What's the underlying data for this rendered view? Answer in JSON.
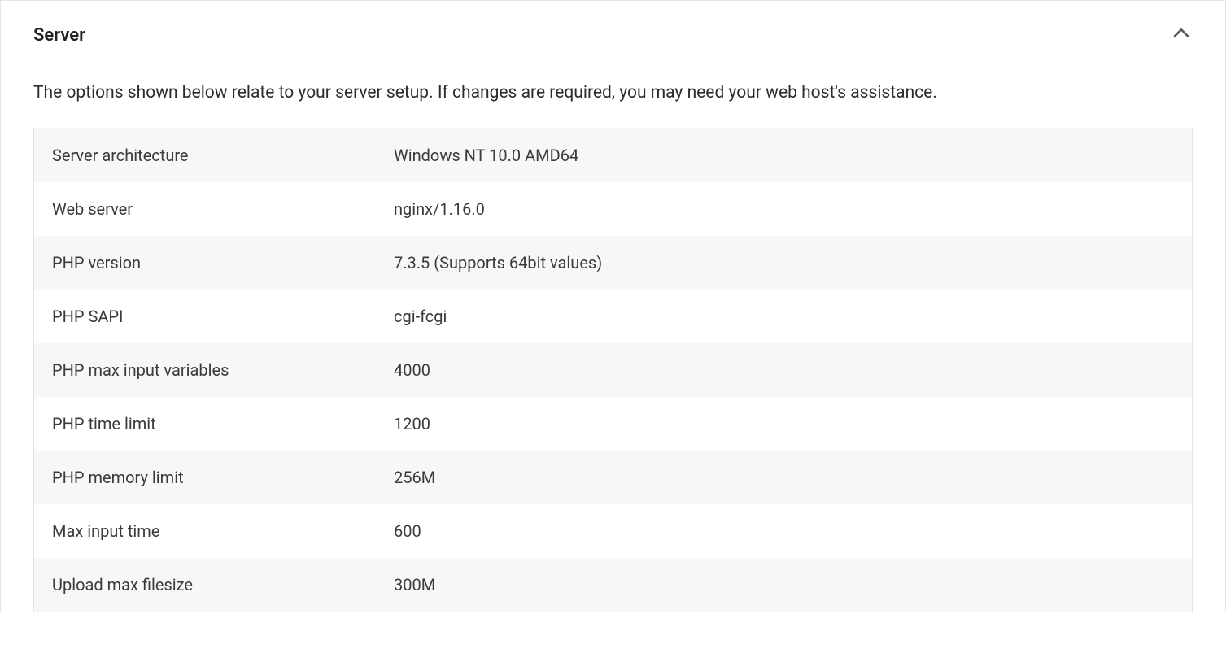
{
  "panel": {
    "title": "Server",
    "description": "The options shown below relate to your server setup. If changes are required, you may need your web host's assistance."
  },
  "rows": [
    {
      "label": "Server architecture",
      "value": "Windows NT 10.0 AMD64"
    },
    {
      "label": "Web server",
      "value": "nginx/1.16.0"
    },
    {
      "label": "PHP version",
      "value": "7.3.5 (Supports 64bit values)"
    },
    {
      "label": "PHP SAPI",
      "value": "cgi-fcgi"
    },
    {
      "label": "PHP max input variables",
      "value": "4000"
    },
    {
      "label": "PHP time limit",
      "value": "1200"
    },
    {
      "label": "PHP memory limit",
      "value": "256M"
    },
    {
      "label": "Max input time",
      "value": "600"
    },
    {
      "label": "Upload max filesize",
      "value": "300M"
    }
  ]
}
